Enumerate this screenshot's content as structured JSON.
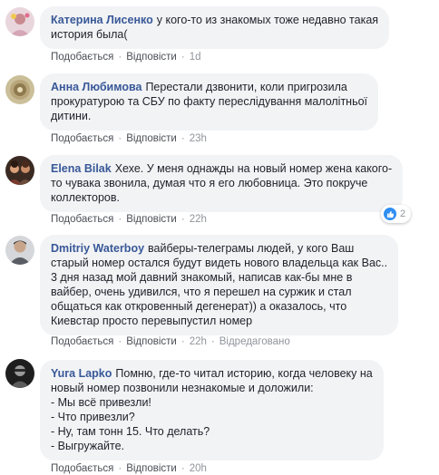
{
  "actions": {
    "like": "Подобається",
    "reply": "Відповісти",
    "separator": "·",
    "edited": "Відредаговано"
  },
  "comments": [
    {
      "author": "Катерина Лисенко",
      "text_lines": [
        "у кого-то из знакомых тоже недавно такая",
        "история была("
      ],
      "time": "1d",
      "avatar_color": "#e9d6dc"
    },
    {
      "author": "Анна Любимова",
      "text_lines": [
        "Перестали дзвонити, коли пригрозила",
        "прокуратурою та СБУ по факту переслідування малолітньої",
        "дитини."
      ],
      "time": "23h",
      "avatar_color": "#b9a57a"
    },
    {
      "author": "Elena Bilak",
      "text_lines": [
        "Хехе. У меня однажды на новый номер жена какого-",
        "то чувака звонила, думая что я его любовница. Это покруче",
        "коллекторов."
      ],
      "time": "22h",
      "reaction_count": "2",
      "avatar_color": "#6b4b3a"
    },
    {
      "author": "Dmitriy Waterboy",
      "text_lines": [
        "вайберы-телеграмы людей, у кого Ваш",
        "старый номер остался будут видеть нового владельца как Вас..",
        "3 дня назад мой давний знакомый, написав как-бы мне в",
        "вайбер, очень удивился, что я перешел на суржик и стал",
        "общаться как откровенный дегенерат)) а оказалось, что",
        "Киевстар просто перевыпустил номер"
      ],
      "time": "22h",
      "avatar_color": "#8c9096"
    },
    {
      "author": "Yura Lapko",
      "text_lines": [
        "Помню, где-то читал историю, когда человеку на",
        "новый номер позвонили незнакомые и доложили:",
        "- Мы всё привезли!",
        "- Что привезли?",
        "- Ну, там тонн 15. Что делать?",
        "- Выгружайте."
      ],
      "time": "20h",
      "avatar_color": "#3b3b3b"
    }
  ]
}
